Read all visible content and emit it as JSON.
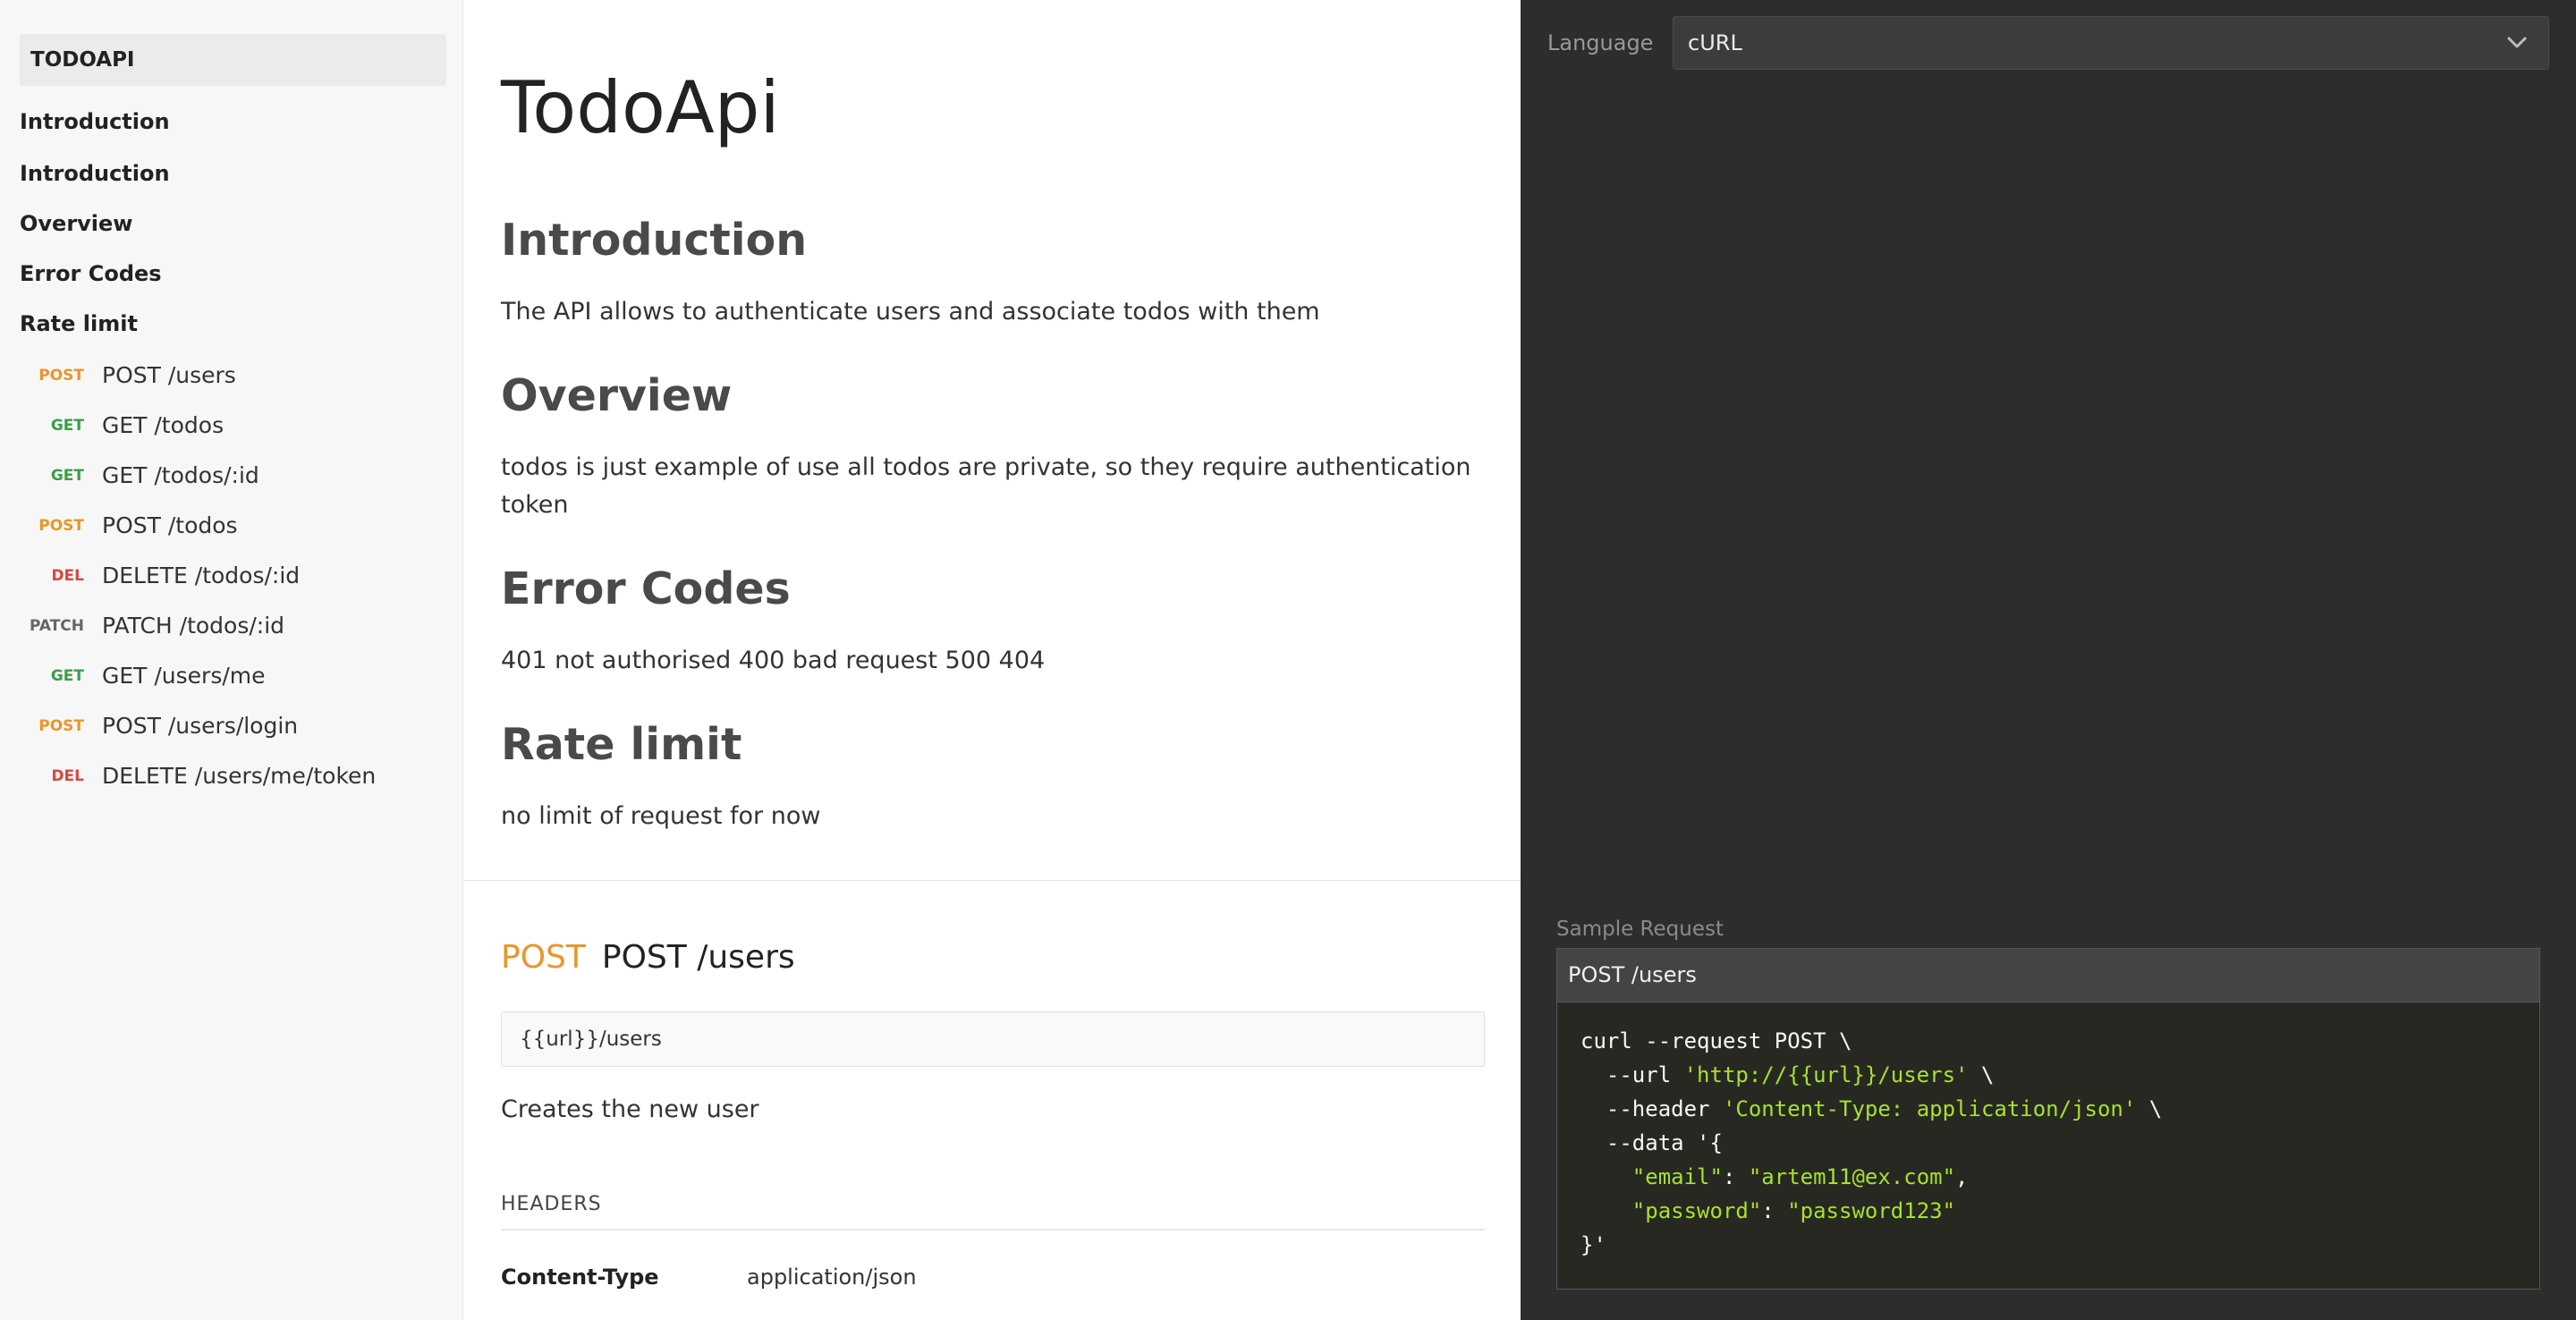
{
  "sidebar": {
    "brand": "TODOAPI",
    "sections": [
      "Introduction",
      "Introduction",
      "Overview",
      "Error Codes",
      "Rate limit"
    ],
    "requests": [
      {
        "method": "POST",
        "path": "POST /users"
      },
      {
        "method": "GET",
        "path": "GET /todos"
      },
      {
        "method": "GET",
        "path": "GET /todos/:id"
      },
      {
        "method": "POST",
        "path": "POST /todos"
      },
      {
        "method": "DEL",
        "path": "DELETE /todos/:id"
      },
      {
        "method": "PATCH",
        "path": "PATCH /todos/:id"
      },
      {
        "method": "GET",
        "path": "GET /users/me"
      },
      {
        "method": "POST",
        "path": "POST /users/login"
      },
      {
        "method": "DEL",
        "path": "DELETE /users/me/token"
      }
    ]
  },
  "main": {
    "title": "TodoApi",
    "sections": [
      {
        "heading": "Introduction",
        "body": "The API allows to authenticate users and associate todos with them"
      },
      {
        "heading": "Overview",
        "body": "todos is just example of use all todos are private, so they require authentication token"
      },
      {
        "heading": "Error Codes",
        "body": "401 not authorised 400 bad request 500 404"
      },
      {
        "heading": "Rate limit",
        "body": "no limit of request for now"
      }
    ],
    "endpoint": {
      "method": "POST",
      "path": "POST /users",
      "url": "{{url}}/users",
      "description": "Creates the new user",
      "headers_label": "HEADERS",
      "header_key": "Content-Type",
      "header_value": "application/json"
    }
  },
  "right": {
    "language_label": "Language",
    "language_value": "cURL",
    "sample_label": "Sample Request",
    "sample_title": "POST /users",
    "code": {
      "line1": "curl --request POST \\",
      "url_flag": "  --url ",
      "url_str": "'http://{{url}}/users'",
      "url_tail": " \\",
      "header_flag": "  --header ",
      "header_str": "'Content-Type: application/json'",
      "header_tail": " \\",
      "data_line": "  --data '{",
      "email_key": "\"email\"",
      "email_val": "\"artem11@ex.com\"",
      "password_key": "\"password\"",
      "password_val": "\"password123\"",
      "end": "}'"
    }
  },
  "colors": {
    "post": "#e8962b",
    "get": "#3a9d46",
    "delete": "#d9463f",
    "patch": "#666666",
    "code_string": "#a6e22e"
  }
}
